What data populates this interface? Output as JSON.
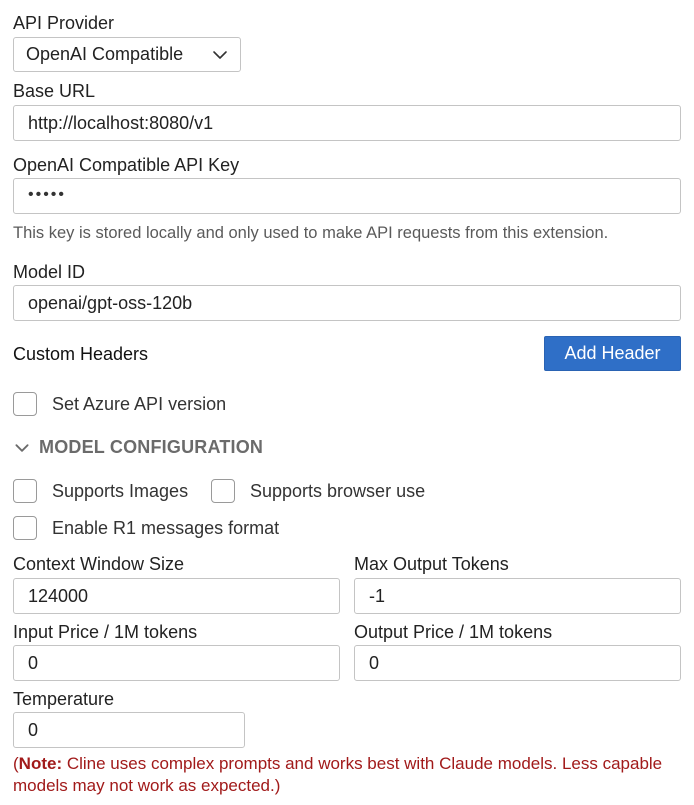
{
  "api_provider": {
    "label": "API Provider",
    "selected": "OpenAI Compatible",
    "icon": "chevron-down-icon"
  },
  "base_url": {
    "label": "Base URL",
    "value": "http://localhost:8080/v1"
  },
  "api_key": {
    "label": "OpenAI Compatible API Key",
    "value": "•••••",
    "hint": "This key is stored locally and only used to make API requests from this extension."
  },
  "model_id": {
    "label": "Model ID",
    "value": "openai/gpt-oss-120b"
  },
  "custom_headers": {
    "label": "Custom Headers",
    "add_button": "Add Header",
    "button_color": "#2f6fc7"
  },
  "azure": {
    "label": "Set Azure API version",
    "checked": false
  },
  "model_config": {
    "title": "MODEL CONFIGURATION",
    "icon": "chevron-down-icon",
    "supports_images": "Supports Images",
    "supports_browser": "Supports browser use",
    "r1_format": "Enable R1 messages format",
    "context_window": {
      "label": "Context Window Size",
      "value": "124000"
    },
    "max_output": {
      "label": "Max Output Tokens",
      "value": "-1"
    },
    "input_price": {
      "label": "Input Price / 1M tokens",
      "value": "0"
    },
    "output_price": {
      "label": "Output Price / 1M tokens",
      "value": "0"
    },
    "temperature": {
      "label": "Temperature",
      "value": "0"
    }
  },
  "note": {
    "prefix": "Note:",
    "text": " Cline uses complex prompts and works best with Claude models. Less capable models may not work as expected.",
    "color": "#a11a1a"
  }
}
